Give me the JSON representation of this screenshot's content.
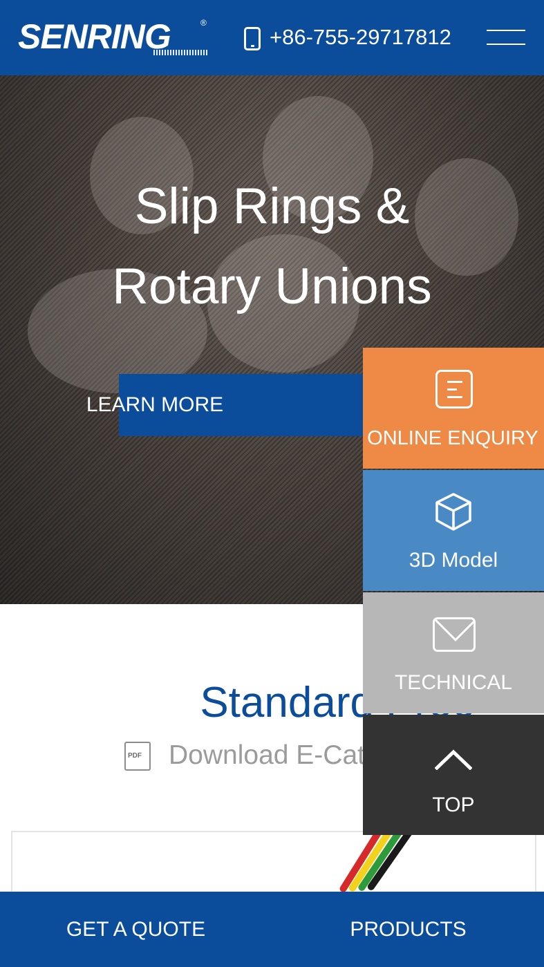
{
  "header": {
    "logo_text": "SENRING",
    "logo_mark": "®",
    "phone_icon": "phone-icon",
    "phone": "+86-755-29717812",
    "menu_icon": "hamburger-menu-icon"
  },
  "hero": {
    "title_line1": "Slip Rings &",
    "title_line2": "Rotary Unions",
    "cta_label": "LEARN MORE"
  },
  "products": {
    "title": "Standard Proc",
    "download_icon_text": "PDF",
    "download_label": "Download E-Cat"
  },
  "side_panel": {
    "items": [
      {
        "label": "ONLINE ENQUIRY",
        "icon": "document-icon",
        "color": "#ee8a45"
      },
      {
        "label": "3D Model",
        "icon": "cube-icon",
        "color": "#4a8ac4"
      },
      {
        "label": "TECHNICAL",
        "icon": "envelope-icon",
        "color": "#b7b7b7"
      },
      {
        "label": "TOP",
        "icon": "chevron-up-icon",
        "color": "#333333"
      }
    ]
  },
  "bottom_bar": {
    "quote_label": "GET A QUOTE",
    "products_label": "PRODUCTS"
  },
  "colors": {
    "brand_blue": "#0b4d9a",
    "accent_orange": "#ee8a45",
    "model_blue": "#4a8ac4",
    "tech_gray": "#b7b7b7",
    "top_dark": "#333333"
  }
}
